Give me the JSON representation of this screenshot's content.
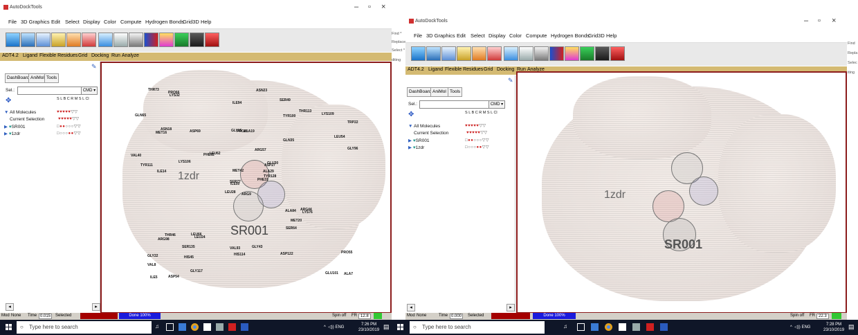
{
  "app": {
    "title": "AutoDockTools"
  },
  "menu": [
    "File",
    "3D Graphics",
    "Edit",
    "Select",
    "Display",
    "Color",
    "Compute",
    "Hydrogen Bonds",
    "Grid3D",
    "Help"
  ],
  "modules": [
    "ADT4.2",
    "Ligand",
    "Flexible Residues",
    "Grid",
    "Docking",
    "Run",
    "Analyze"
  ],
  "dashboard": {
    "tabs": [
      "DashBoard",
      "AniMol",
      "Tools"
    ],
    "sel_label": "Sel.:",
    "cmd_label": "CMD",
    "col_header": "S L B C R M S L Cl",
    "tree": [
      "All Molecules",
      "Current Selection",
      "SR001",
      "1zdr"
    ]
  },
  "viewer": {
    "ligand_label": "SR001",
    "chain_label": "1zdr"
  },
  "left_residues": [
    "ARG9",
    "MET16",
    "ILE50",
    "GLY22",
    "ASP27",
    "LEU24",
    "SER49",
    "ALA19",
    "TYR100",
    "PHE31",
    "LYS32",
    "ALA7",
    "ILE14",
    "TRP22",
    "LEU28",
    "GLN35",
    "ASP54",
    "GLY15",
    "ARG57",
    "THR46",
    "LEU62",
    "VAL8",
    "HIS45",
    "PRO21",
    "GLU30",
    "LYS76",
    "ASN18",
    "ILE94",
    "TYR111",
    "ALA84",
    "GLY96",
    "SER77",
    "VAL93",
    "MET42",
    "ASP69",
    "THR113",
    "LEU66",
    "GLU101",
    "PRO55",
    "ARG44",
    "ASN23",
    "PHE92",
    "LYS106",
    "SER64",
    "GLY117",
    "VAL40",
    "ALA29",
    "ILE5",
    "HIS114",
    "TYR128",
    "ARG98",
    "LEU54",
    "GLN65",
    "MET20",
    "ASP122",
    "SER135",
    "PRO66",
    "THR73",
    "GLY43",
    "LYS109"
  ],
  "right_pane": {
    "side_labels_left": [
      "Find *",
      "Replace",
      "Select *",
      "diting"
    ],
    "side_labels_right": [
      "Find",
      "Repla",
      "Selec",
      "iting"
    ]
  },
  "status_left": {
    "mod": "Mod",
    "none": "None",
    "time": "Time",
    "time_value": "0.015",
    "selected": "Selected",
    "done": "Done 100%",
    "spin": "Spin off",
    "fr": "FR",
    "fr_value": "12.8"
  },
  "status_right": {
    "mod": "Mod",
    "none": "None",
    "time": "Time",
    "time_value": "0.000",
    "selected": "Selected",
    "done": "Done 100%",
    "spin": "Spin off",
    "fr": "FR",
    "fr_value": "22.3"
  },
  "taskbar": {
    "search_placeholder": "Type here to search",
    "lang": "ENG",
    "time_left": "7:26 PM",
    "date_left": "23/10/2019",
    "time_right": "7:28 PM",
    "date_right": "23/10/2019"
  }
}
